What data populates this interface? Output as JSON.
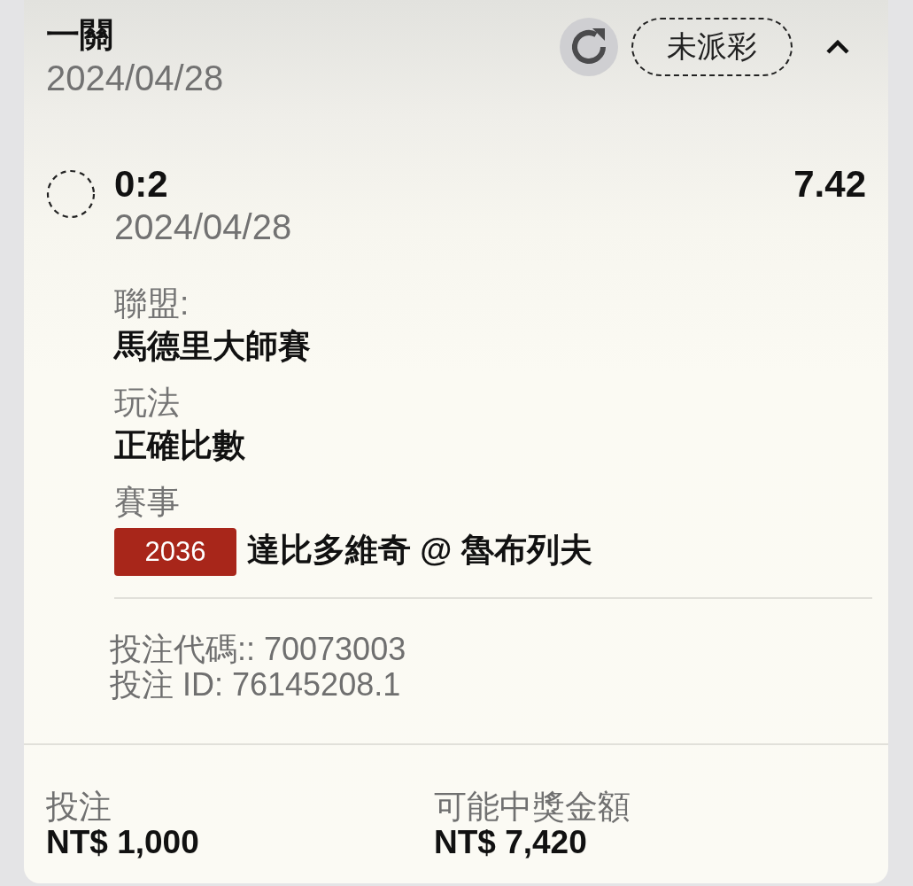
{
  "bet": {
    "type": "一關",
    "date": "2024/04/28",
    "status": "未派彩",
    "expanded": true
  },
  "selections": [
    {
      "selection": "0:2",
      "date": "2024/04/28",
      "odds": "7.42",
      "details": [
        {
          "label": "聯盟:",
          "value": "馬德里大師賽"
        },
        {
          "label": "玩法",
          "value": "正確比數"
        },
        {
          "label": "賽事",
          "match_code": "2036",
          "value": "達比多維奇 @ 魯布列夫"
        }
      ]
    }
  ],
  "references": [
    "投注代碼:: 70073003",
    "投注 ID: 76145208.1"
  ],
  "summary": [
    {
      "label": "投注",
      "value": "NT$ 1,000"
    },
    {
      "label": "可能中獎金額",
      "value": "NT$ 7,420"
    }
  ]
}
